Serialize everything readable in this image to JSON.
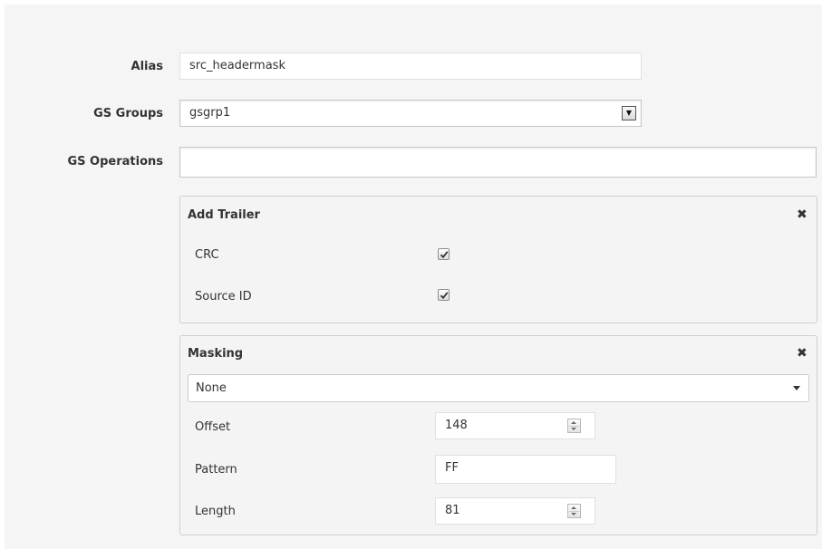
{
  "form": {
    "alias": {
      "label": "Alias",
      "value": "src_headermask"
    },
    "gs_groups": {
      "label": "GS Groups",
      "value": "gsgrp1"
    },
    "gs_operations": {
      "label": "GS Operations",
      "value": ""
    }
  },
  "add_trailer": {
    "title": "Add Trailer",
    "close_icon": "close-icon",
    "crc": {
      "label": "CRC",
      "checked": true
    },
    "source_id": {
      "label": "Source ID",
      "checked": true
    }
  },
  "masking": {
    "title": "Masking",
    "close_icon": "close-icon",
    "mode": "None",
    "offset": {
      "label": "Offset",
      "value": "148"
    },
    "pattern": {
      "label": "Pattern",
      "value": "FF"
    },
    "length": {
      "label": "Length",
      "value": "81"
    }
  },
  "colors": {
    "background": "#f5f5f5",
    "panel": "#f4f4f4",
    "panel_border": "#cfcfcf",
    "text": "#333333"
  }
}
